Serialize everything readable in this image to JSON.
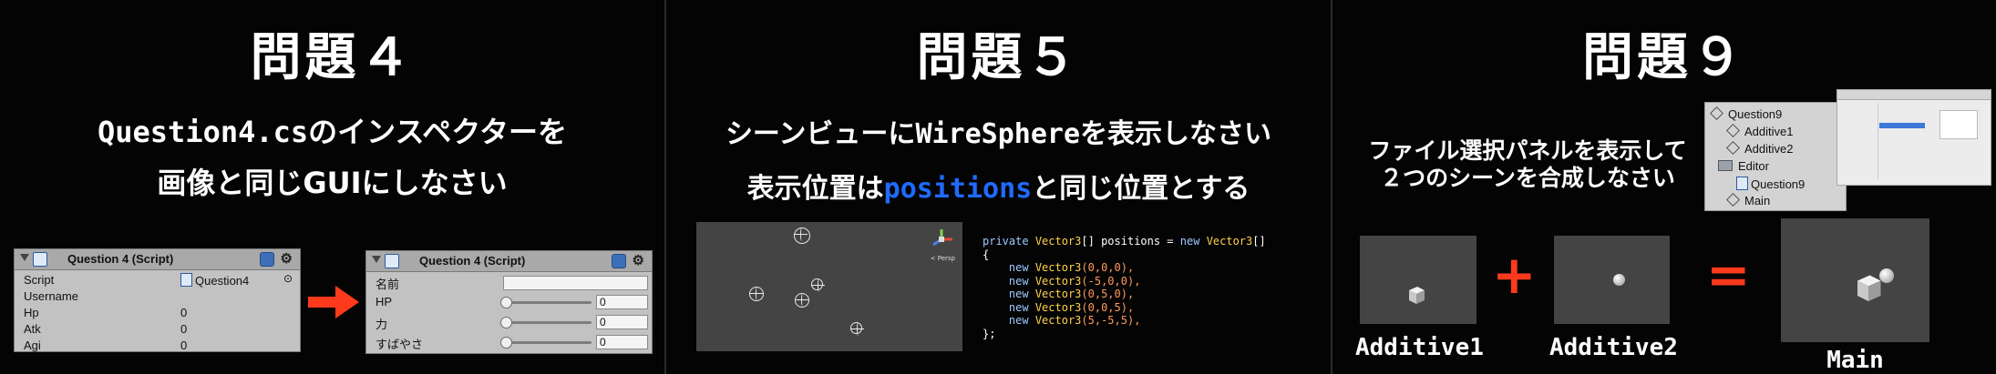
{
  "panels": [
    {
      "title": "問題４",
      "lines": [
        "Question4.csのインスペクターを",
        "画像と同じGUIにしなさい"
      ],
      "inspector_before": {
        "header": "Question 4 (Script)",
        "rows": [
          {
            "label": "Script",
            "value": "Question4"
          },
          {
            "label": "Username",
            "value": ""
          },
          {
            "label": "Hp",
            "value": "0"
          },
          {
            "label": "Atk",
            "value": "0"
          },
          {
            "label": "Agi",
            "value": "0"
          }
        ]
      },
      "inspector_after": {
        "header": "Question 4 (Script)",
        "rows": [
          {
            "label": "名前",
            "value": ""
          },
          {
            "label": "HP",
            "value": "0"
          },
          {
            "label": "力",
            "value": "0"
          },
          {
            "label": "すばやさ",
            "value": "0"
          }
        ]
      },
      "arrow_color": "#ff3a1c"
    },
    {
      "title": "問題５",
      "line1_pre": "シーンビューに",
      "line1_mono": "WireSphere",
      "line1_post": "を表示しなさい",
      "line2_pre": "表示位置は",
      "line2_blue": "positions",
      "line2_post": "と同じ位置とする",
      "code": {
        "l1_kw": "private",
        "l1_ty": "Vector3",
        "l1_mid": "[] positions = ",
        "l1_kw2": "new",
        "l1_ty2": "Vector3",
        "l1_end": "[]",
        "open": "{",
        "entries": [
          {
            "args": "(0,0,0),"
          },
          {
            "args": "(-5,0,0),"
          },
          {
            "args": "(0,5,0),"
          },
          {
            "args": "(0,0,5),"
          },
          {
            "args": "(5,-5,5),"
          }
        ],
        "close": "};"
      },
      "gizmo_label": "< Persp"
    },
    {
      "title": "問題９",
      "lines": [
        "ファイル選択パネルを表示して",
        "２つのシーンを合成しなさい"
      ],
      "hierarchy": [
        "Question9",
        "Additive1",
        "Additive2",
        "Editor",
        "Question9",
        "Main"
      ],
      "captions": [
        "Additive1",
        "Additive2",
        "Main"
      ],
      "plus": "+",
      "equals": "="
    }
  ]
}
